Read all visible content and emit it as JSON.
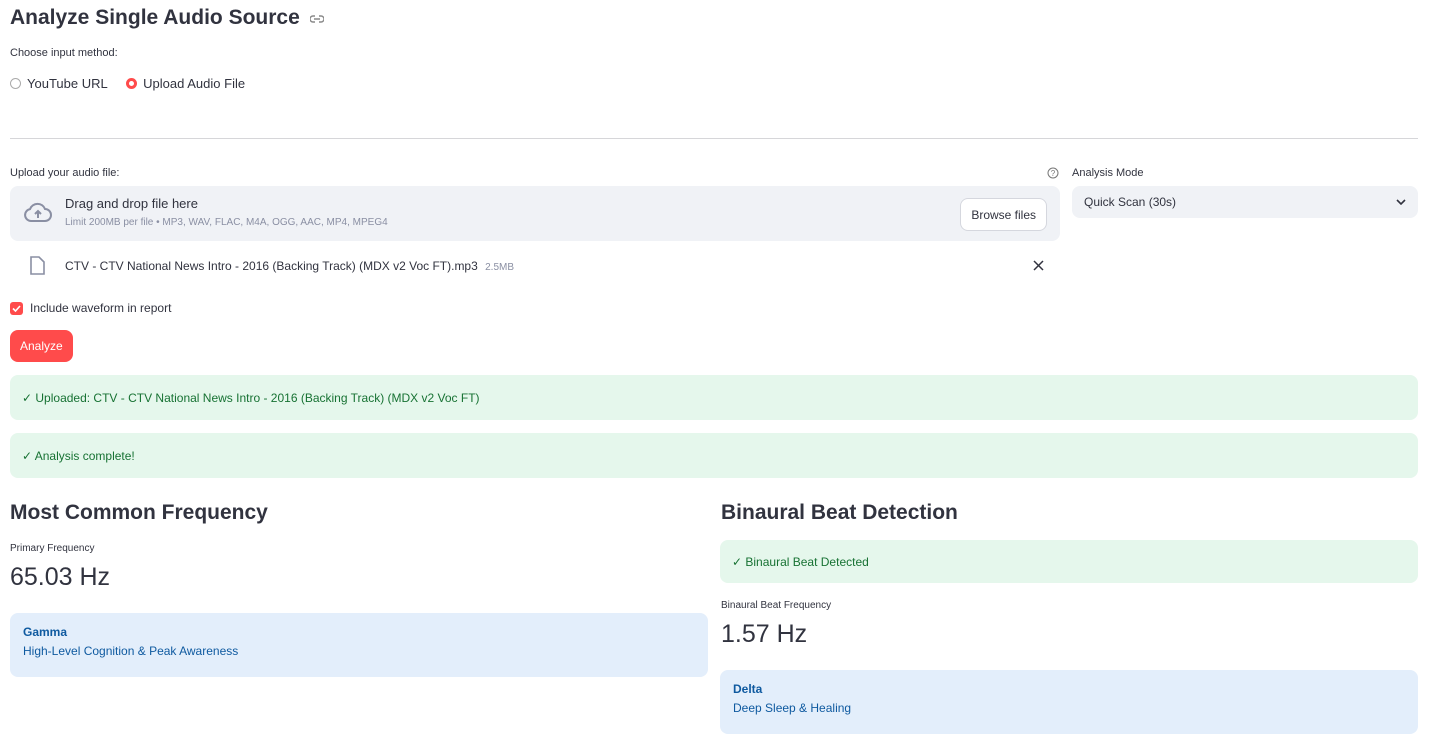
{
  "header": {
    "title": "Analyze Single Audio Source"
  },
  "input_method": {
    "label": "Choose input method:",
    "options": [
      "YouTube URL",
      "Upload Audio File"
    ],
    "selected": "Upload Audio File"
  },
  "uploader": {
    "label": "Upload your audio file:",
    "drag_text": "Drag and drop file here",
    "limit_text": "Limit 200MB per file • MP3, WAV, FLAC, M4A, OGG, AAC, MP4, MPEG4",
    "browse_label": "Browse files",
    "file_name": "CTV - CTV National News Intro - 2016 (Backing Track) (MDX v2 Voc FT).mp3",
    "file_size": "2.5MB"
  },
  "mode": {
    "label": "Analysis Mode",
    "value": "Quick Scan (30s)"
  },
  "checkbox": {
    "label": "Include waveform in report",
    "checked": true
  },
  "analyze_label": "Analyze",
  "alerts": {
    "uploaded": "✓ Uploaded: CTV - CTV National News Intro - 2016 (Backing Track) (MDX v2 Voc FT)",
    "complete": "✓ Analysis complete!"
  },
  "frequency": {
    "title": "Most Common Frequency",
    "metric_label": "Primary Frequency",
    "value": "65.03 Hz",
    "band": "Gamma",
    "band_desc": "High-Level Cognition & Peak Awareness"
  },
  "binaural": {
    "title": "Binaural Beat Detection",
    "detected": "✓ Binaural Beat Detected",
    "metric_label": "Binaural Beat Frequency",
    "value": "1.57 Hz",
    "band": "Delta",
    "band_desc": "Deep Sleep & Healing"
  },
  "colors": {
    "accent": "#ff4b4b",
    "success_bg": "#e5f7ec",
    "success_text": "#177233",
    "info_bg": "#e3eefb",
    "info_text": "#0f5aa0"
  }
}
